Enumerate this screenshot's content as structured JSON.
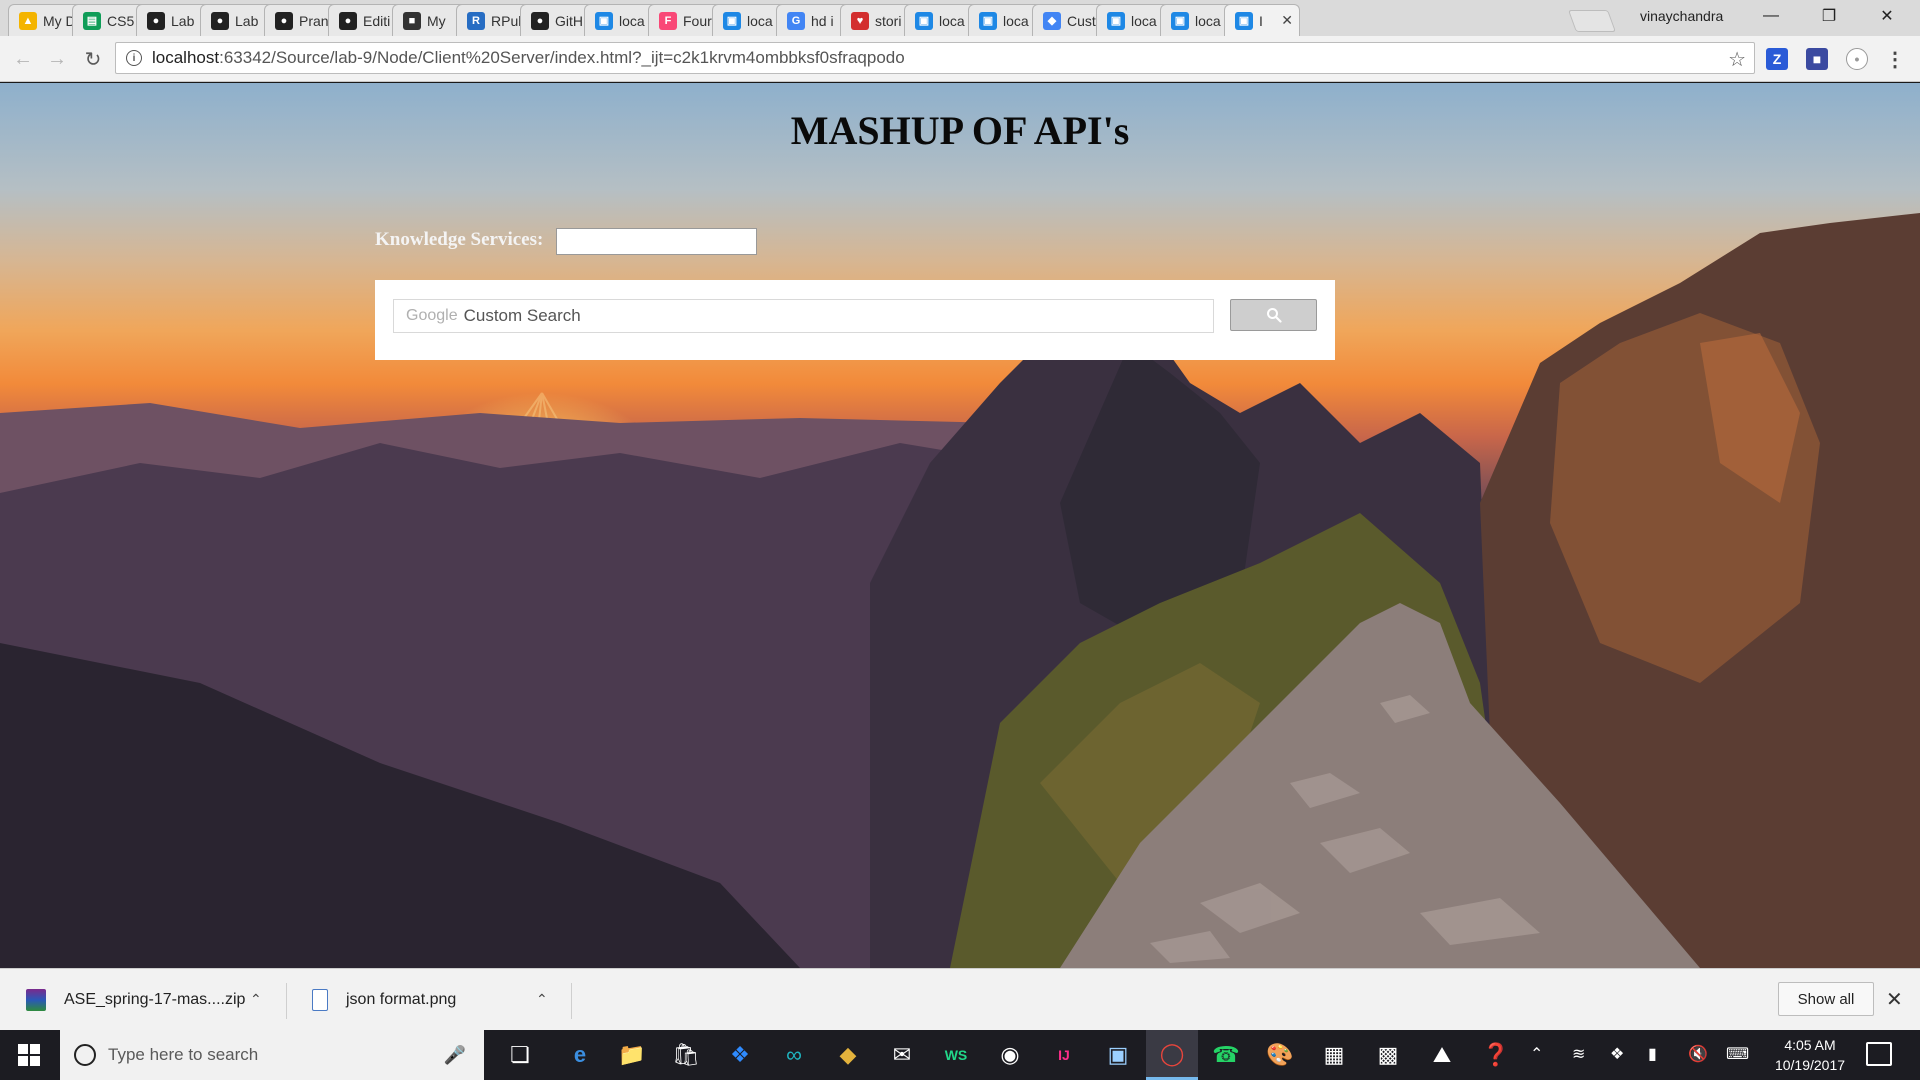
{
  "browser": {
    "tabs": [
      {
        "label": "My D",
        "favicon": "google-drive-icon",
        "color": "#f4b400"
      },
      {
        "label": "CS5",
        "favicon": "sheets-icon",
        "color": "#0f9d58"
      },
      {
        "label": "Lab",
        "favicon": "github-icon",
        "color": "#222222"
      },
      {
        "label": "Lab",
        "favicon": "github-icon",
        "color": "#222222"
      },
      {
        "label": "Pran",
        "favicon": "github-icon",
        "color": "#222222"
      },
      {
        "label": "Editi",
        "favicon": "github-icon",
        "color": "#222222"
      },
      {
        "label": "My",
        "favicon": "imdb-icon",
        "color": "#333333"
      },
      {
        "label": "RPul",
        "favicon": "r-icon",
        "color": "#276dc3"
      },
      {
        "label": "GitH",
        "favicon": "github-icon",
        "color": "#222222"
      },
      {
        "label": "loca",
        "favicon": "webstorm-icon",
        "color": "#1e88e5"
      },
      {
        "label": "Four",
        "favicon": "foursquare-icon",
        "color": "#f94877"
      },
      {
        "label": "loca",
        "favicon": "webstorm-icon",
        "color": "#1e88e5"
      },
      {
        "label": "hd i",
        "favicon": "google-icon",
        "color": "#4285f4"
      },
      {
        "label": "stori",
        "favicon": "heart-icon",
        "color": "#d32f2f"
      },
      {
        "label": "loca",
        "favicon": "webstorm-icon",
        "color": "#1e88e5"
      },
      {
        "label": "loca",
        "favicon": "webstorm-icon",
        "color": "#1e88e5"
      },
      {
        "label": "Cust",
        "favicon": "google-cse-icon",
        "color": "#4285f4"
      },
      {
        "label": "loca",
        "favicon": "webstorm-icon",
        "color": "#1e88e5"
      },
      {
        "label": "loca",
        "favicon": "webstorm-icon",
        "color": "#1e88e5"
      },
      {
        "label": "I",
        "favicon": "webstorm-icon",
        "color": "#1e88e5",
        "active": true
      }
    ],
    "profile_name": "vinaychandra",
    "url_host": "localhost",
    "url_rest": ":63342/Source/lab-9/Node/Client%20Server/index.html?_ijt=c2k1krvm4ombbksf0sfraqpodo"
  },
  "page": {
    "title": "MASHUP OF API's",
    "knowledge_label": "Knowledge Services:",
    "knowledge_value": "",
    "search_brand": "Google",
    "search_placeholder": "Custom Search"
  },
  "downloads": {
    "items": [
      {
        "name": "ASE_spring-17-mas....zip",
        "icon": "zip-archive-icon"
      },
      {
        "name": "json format.png",
        "icon": "image-file-icon"
      }
    ],
    "show_all": "Show all"
  },
  "taskbar": {
    "search_placeholder": "Type here to search",
    "time": "4:05 AM",
    "date": "10/19/2017"
  }
}
